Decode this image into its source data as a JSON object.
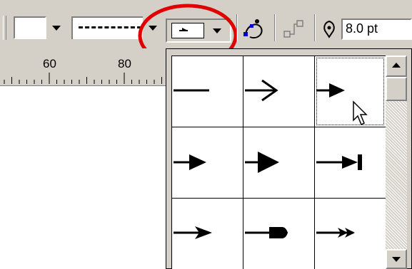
{
  "toolbar": {
    "fill_color_dropdown": "fill-color-dropdown",
    "line_style_dropdown": "line-style-dropdown",
    "arrow_style_dropdown": "arrow-style-dropdown",
    "line_width_value": "8.0 pt"
  },
  "ruler": {
    "labels": [
      "60",
      "80"
    ]
  },
  "arrow_popup": {
    "styles": [
      {
        "name": "plain-line"
      },
      {
        "name": "open-arrow"
      },
      {
        "name": "filled-arrow-small",
        "selected": true
      },
      {
        "name": "filled-arrow"
      },
      {
        "name": "filled-arrow-large"
      },
      {
        "name": "arrow-to-bar"
      },
      {
        "name": "barbed-arrow"
      },
      {
        "name": "round-head-arrow"
      },
      {
        "name": "double-barbed-arrow"
      }
    ]
  },
  "highlight": {
    "color": "#e00000"
  }
}
